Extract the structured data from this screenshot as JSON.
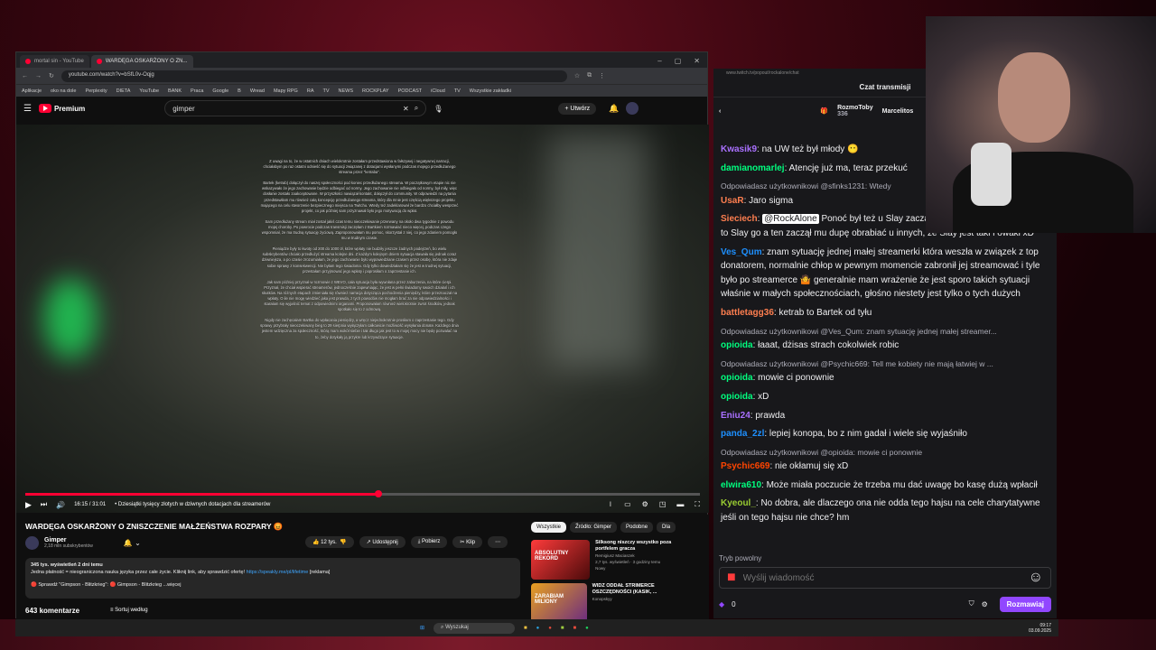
{
  "browser": {
    "tabs": [
      {
        "label": "mortal sin - YouTube",
        "color": "#ff0033"
      },
      {
        "label": "WARDĘGA OSKARŻONY O ZN...",
        "color": "#ff0033"
      }
    ],
    "url": "youtube.com/watch?v=bSfL0v-Oqjg",
    "bookmarks": [
      "Aplikacje",
      "oko na dole",
      "Perplexity",
      "DIETA",
      "YouTube",
      "BANK",
      "Praca",
      "Google",
      "B",
      "Wread",
      "Mapy RPG",
      "RA",
      "TV",
      "NEWS",
      "ROCKPLAY",
      "PODCAST",
      "iCloud",
      "TV",
      "Wszystkie zakładki"
    ]
  },
  "youtube": {
    "logo": "Premium",
    "search_value": "gimper",
    "create_label": "Utwórz",
    "statement": [
      "Z uwagi na to, że w ostatnich dniach wielokrotnie zostałam przedstawiona w fałszywej i negatywnej narracji, chciałabym po raz ostatni odnieść się do sytuacji związanej z dotacjami wysłanymi podczas mojego przedłużanego streama przez \"ketraba\".",
      "Bartek (ketrab) dołączył do naszej społeczności pod koniec przedłużanego streama. W początkowym etapie nic nie wskazywało że jego zachowanie będzie odbiegać od normy. Jego zachowanie nie odbiegało od normy, był miły, więc dosłanie zostało zaakceptowane. W przyszłości nawiązał kontakt, dołączył do community. W odpowiedzi na pytania przedstawiłam mu również całą koncepcję przedłużanego streama, który dla mnie jest częścią większego projektu mającego na celu stworzenie bezpiecznego miejsca na Twitchu. Wtedy też zadeklarował że bardzo chciałby wesprzeć projekt, co jak później sam przyznawał było jego motywacją do wpłat.",
      "Sam przedłużany stream miał został jakiś czas temu nieoczekiwanie przerwany na około dwa tygodnie z powodu mojej choroby. Po powrocie podczas transmisji zaczęłam z Bartkiem rozmawiać nieco więcej, podczas czego wspomniał, że ma trudną sytuację życiową. Zaproponowałam mu pomoc, skorzystał z niej, co jego zdaniem pomogło mu w trudnym czasie.",
      "Pieniądze były to kwoty od 200 do 1000 zł, które wpłaty nie budziły jeszcze żadnych podejrzeń, bo wielu subskrybentów chciało przedłużyć streama kolejne dni. Z każdym kolejnym dniem sytuacja stawała się jednak coraz dziwniejsza, a po czasie zrozumiałam, że jego zachowanie było wypowiedziane czasem przez osobę, która nie zdaje sobie sprawy z konsekwencji. Nie byłam tego świadoma. Gdy tylko dowiedziałam się że jest w trudnej sytuacji, przestałam przyjmować jego wpłaty i poprosiłam o zaprzestanie ich.",
      "Jak sam później przyznał w rozmowie z WEVO, cała sytuacja była wywołana przez zaburzenia, na które cierpi. Przyznał, że chciał wspierać streamerów, jednocześnie zapewniając, że jest w pełni świadomy swoich działań i ich skutków. Na różnych etapach zmieniała się również narracja dotycząca pochodzenia pieniędzy, które przeznaczał na wpłaty. O ile nie mogę wiedzieć jaka jest prawda, z tych powodów nie mogłam brać za nie odpowiedzialności i starałam się wyjaśnić temat z odpowiednimi organami. Proponowałam również wielokrotnie zwrot środków, jednak spotkało się to z odmową.",
      "Nigdy nie zachęcałam Bartka do wpłacania pieniędzy, a wręcz niejednokrotnie prosiłam o zaprzestanie tego. Gdy sprawy przybrały nieoczekiwany bieg to 29 sierpnia wyłączyłam całkowicie możliwość wysyłania donate. Każdego dnia jestem wdzięczna za społeczność, którą mam wokół siebie i tak długo jak jest to w mojej mocy nie będę pozwalać na to, żeby dotykały ją przykre lub krzywdzące sytuacje."
    ],
    "time": "16:15 / 31:01",
    "chapter": "• Dziesiątki tysięcy złotych w dziwnych dotacjach dla streamerów",
    "progress": 0.523,
    "title": "WARDĘGA OSKARŻONY O ZNISZCZENIE MAŁŻEŃSTWA ROZPARY 😡",
    "channel": "Gimper",
    "subscribers": "2,18 mln subskrybentów",
    "likes": "12 tys.",
    "share": "Udostępnij",
    "download": "Pobierz",
    "clip": "Klip",
    "views": "345 tys. wyświetleń  2 dni temu",
    "desc_line1": "Jedna płatność = nieograniczona nauka języka przez całe życie. Kliknij link, aby sprawdzić ofertę!",
    "desc_link": "https://speakly.me/pl/lifetime",
    "desc_tag": "[reklama]",
    "desc_line2": "🔴 Sprawdź \"Gimpson - Blitzkrieg\": 🔴 Gimpson - Blitzkrieg  ...więcej",
    "comments": "643 komentarze",
    "sort": "Sortuj według",
    "chips": [
      "Wszystkie",
      "Źródło: Gimper",
      "Podobne",
      "Dla"
    ],
    "recs": [
      {
        "thumb": "ABSOLUTNY REKORD",
        "title": "Silksong niszczy wszystko poza portfelem gracza",
        "channel": "Remigiusz Maciaszek",
        "meta": "2,7 tys. wyświetleń · 3 godziny temu",
        "badge": "Nowy",
        "duration": "1:12:14"
      },
      {
        "thumb": "ZARABIAM MILIONY",
        "title": "WIDZ ODDAŁ STRIMERCE OSZCZĘDNOŚCI (KASIK, ...",
        "channel": "Konopskyy",
        "meta": "",
        "badge": "",
        "duration": ""
      }
    ]
  },
  "chat": {
    "url": "www.twitch.tv/popout/rockalone/chat",
    "header": "Czat transmisji",
    "pinned": [
      {
        "name": "RozmoToby",
        "count": "336"
      },
      {
        "name": "Marcelitos",
        "count": ""
      }
    ],
    "messages": [
      {
        "user": "Kwasik9",
        "color": "#a970ff",
        "text": ": na UW też był młody 😶",
        "reply": ""
      },
      {
        "user": "damianomarlej",
        "color": "#00ff7f",
        "text": ": Atencję już ma, teraz przekuć",
        "reply": ""
      },
      {
        "user": "UsaR",
        "color": "#ff7f50",
        "text": ": Jaro sigma",
        "reply": "Odpowiadasz użytkownikowi @sfinks1231: Wtedy"
      },
      {
        "user": "Sieciech",
        "color": "#ff7f50",
        "mention": "@RockAlone",
        "text": " Ponoć był też u Slay zaczął łazić po innych streamerach, to Slay go a ten zaczął mu dupę obrabiać u innych, że Slay jest taki i owaki xD",
        "reply": ""
      },
      {
        "user": "Ves_Qum",
        "color": "#1e90ff",
        "text": ": znam sytuację jednej małej streamerki która weszła w związek z top donatorem, normalnie chłop w pewnym momencie zabronił jej streamować i tyle było po streamerce 🤷 generalnie mam wrażenie że jest sporo takich sytuacji właśnie w małych społecznościach, głośno niestety jest tylko o tych dużych",
        "reply": ""
      },
      {
        "user": "battletagg36",
        "color": "#ff7f50",
        "text": ": ketrab to Bartek od tyłu",
        "reply": ""
      },
      {
        "user": "opioida",
        "color": "#00ff7f",
        "text": ": łaaat, dżisas strach cokolwiek robic",
        "reply": "Odpowiadasz użytkownikowi @Ves_Qum: znam sytuację jednej małej streamer..."
      },
      {
        "user": "opioida",
        "color": "#00ff7f",
        "text": ": mowie ci ponownie",
        "reply": "Odpowiadasz użytkownikowi @Psychic669: Tell me kobiety nie mają łatwiej w ..."
      },
      {
        "user": "opioida",
        "color": "#00ff7f",
        "text": ": xD",
        "reply": ""
      },
      {
        "user": "Eniu24",
        "color": "#a970ff",
        "text": ": prawda",
        "reply": ""
      },
      {
        "user": "panda_2zl",
        "color": "#1e90ff",
        "text": ": lepiej konopa, bo z nim gadał i wiele się wyjaśniło",
        "reply": ""
      },
      {
        "user": "Psychic669",
        "color": "#ff4500",
        "text": ": nie okłamuj się xD",
        "reply": "Odpowiadasz użytkownikowi @opioida: mowie ci ponownie"
      },
      {
        "user": "elwira610",
        "color": "#00ff7f",
        "text": ": Może miała poczucie że trzeba mu dać uwagę bo kasę dużą wpłacił",
        "reply": ""
      },
      {
        "user": "Kyeoul_",
        "color": "#9acd32",
        "text": ": No dobra, ale dlaczego ona nie odda tego hajsu na cele charytatywne jeśli on tego hajsu nie chce? hm",
        "reply": ""
      }
    ],
    "slow_mode": "Tryb powolny",
    "input_placeholder": "Wyślij wiadomość",
    "points": "0",
    "send_label": "Rozmawiaj"
  },
  "taskbar": {
    "search_placeholder": "Wyszukaj",
    "time": "09:17",
    "date": "03.09.2025"
  }
}
